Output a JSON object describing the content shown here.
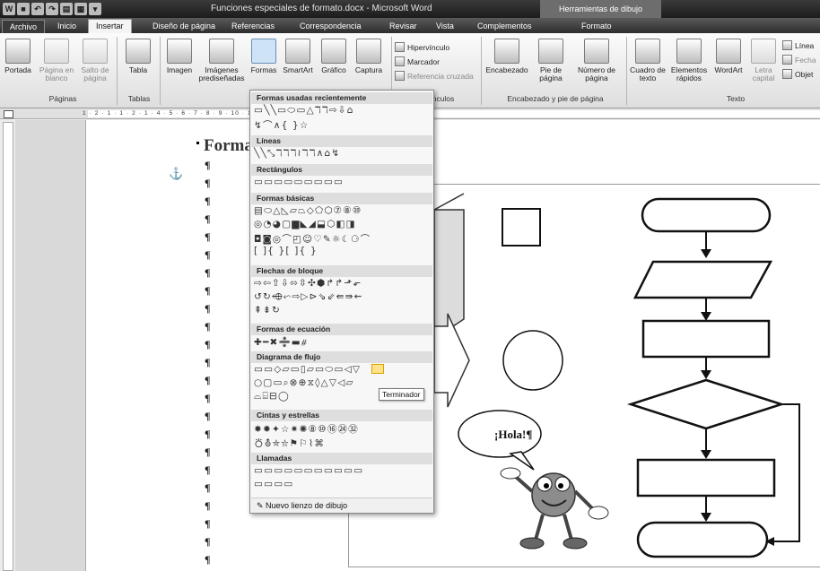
{
  "window": {
    "title": "Funciones especiales de formato.docx - Microsoft Word",
    "context_group": "Herramientas de dibujo"
  },
  "tabs": [
    "Archivo",
    "Inicio",
    "Insertar",
    "Diseño de página",
    "Referencias",
    "Correspondencia",
    "Revisar",
    "Vista",
    "Complementos",
    "Formato"
  ],
  "active_tab": "Insertar",
  "ribbon": {
    "paginas": {
      "label": "Páginas",
      "portada": "Portada",
      "pagina_blanco": "Página en blanco",
      "salto": "Salto de página"
    },
    "tablas": {
      "label": "Tablas",
      "tabla": "Tabla"
    },
    "ilustraciones": {
      "imagen": "Imagen",
      "imagenes": "Imágenes prediseñadas",
      "formas": "Formas",
      "smartart": "SmartArt",
      "grafico": "Gráfico",
      "captura": "Captura"
    },
    "vinculos": {
      "label": "Vínculos",
      "hipervinculo": "Hipervínculo",
      "marcador": "Marcador",
      "referencia": "Referencia cruzada"
    },
    "encabezado": {
      "label": "Encabezado y pie de página",
      "encabezado": "Encabezado",
      "pie": "Pie de página",
      "numero": "Número de página"
    },
    "texto": {
      "label": "Texto",
      "cuadro": "Cuadro de texto",
      "elementos": "Elementos rápidos",
      "wordart": "WordArt",
      "letra": "Letra capital",
      "linea": "Línea",
      "fecha": "Fecha",
      "objeto": "Objet"
    }
  },
  "document": {
    "title": "Forma",
    "anchor": "⚓",
    "pilcrow": "¶",
    "speech": "¡Hola!¶"
  },
  "shapes_gallery": {
    "sections": [
      {
        "title": "Formas usadas recientemente",
        "rows": [
          "▭╲╲▭⬭▭△ℸℸ⇨⇩⌂",
          "↯⌒∧{ }☆"
        ]
      },
      {
        "title": "Líneas",
        "rows": [
          "╲╲⤡ℸℸℸ≀ℸℸ∧⌂↯"
        ]
      },
      {
        "title": "Rectángulos",
        "rows": [
          "▭▭▭▭▭▭▭▭▭"
        ]
      },
      {
        "title": "Formas básicas",
        "rows": [
          "▤⬭△◺▱⏢◇⬠⬡⑦⑧⑩",
          "◎◔◕▢▆◣◢⬓⬡◧◨",
          "◘◙◎⌒◰☺♡✎☼☾⚆⌒",
          "[ ]{ }[ ]{ }"
        ]
      },
      {
        "title": "Flechas de bloque",
        "rows": [
          "⇨⇦⇧⇩⬄⇳✣⬢↱↱⬏⬐",
          "↺↻⬲⬿⇨▷⊳⇘⇙⇚⇛⇜",
          "⇞⇟↻"
        ]
      },
      {
        "title": "Formas de ecuación",
        "rows": [
          "✚━✖➗▬⧣"
        ]
      },
      {
        "title": "Diagrama de flujo",
        "rows": [
          "▭▭◇▱▭▯▱▭⬭▭◁▽",
          "○▢▭⌕⊗⊕⧖◊△▽◁▱",
          "⌓⌸⊟◯"
        ]
      },
      {
        "title": "Cintas y estrellas",
        "rows": [
          "✸✹✦☆✷✺⑧⑩⑯㉔㉜",
          "⛣⛢⛤⛥⚑⚐⌇⌘"
        ]
      },
      {
        "title": "Llamadas",
        "rows": [
          "▭▭▭▭▭▭▭▭▭▭▭",
          "▭▭▭▭"
        ]
      }
    ],
    "footer": "Nuevo lienzo de dibujo",
    "tooltip": "Terminador"
  },
  "ruler_text": "1 · 2 · 1 · 1 · 2 · 1 · 4 · 5 · 6 · 7 · 8 · 9 · 10 · 11 · 12 · 13 · 14 · 15 · 16 · 17"
}
